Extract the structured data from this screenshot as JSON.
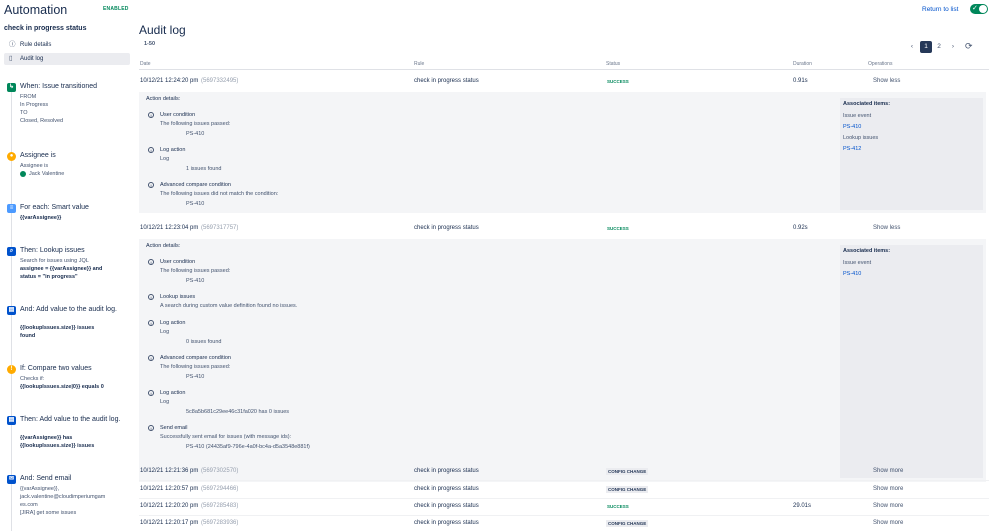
{
  "header": {
    "app_title": "Automation",
    "status_badge": "ENABLED",
    "return_link": "Return to list",
    "toggle_on": true
  },
  "sidebar": {
    "rule_name": "check in progress status",
    "nav": [
      {
        "label": "Rule details",
        "icon": "info-icon"
      },
      {
        "label": "Audit log",
        "icon": "document-icon",
        "active": true
      }
    ],
    "steps": [
      {
        "title": "When: Issue transitioned",
        "icon": "trigger-icon",
        "color": "#00875a",
        "lines": [
          "FROM",
          "In Progress",
          "TO",
          "Closed, Resolved"
        ]
      },
      {
        "title": "Assignee is",
        "icon": "user-condition-icon",
        "color": "#ffab00",
        "lines": [
          "Assignee is",
          "Jack Valentine"
        ]
      },
      {
        "title": "For each: Smart value",
        "icon": "branch-icon",
        "color": "#4c9aff",
        "lines": [
          "{{varAssignee}}"
        ]
      },
      {
        "title": "Then: Lookup issues",
        "icon": "lookup-icon",
        "color": "#0052cc",
        "lines": [
          "Search for issues using JQL",
          "assignee = {{varAssignee}} and",
          "status = \"in progress\""
        ]
      },
      {
        "title": "And: Add value to the audit log.",
        "icon": "log-icon",
        "color": "#0052cc",
        "lines": [
          "{{lookupIssues.size}} issues",
          "found"
        ]
      },
      {
        "title": "If: Compare two values",
        "icon": "compare-icon",
        "color": "#ffab00",
        "lines": [
          "Checks if:",
          "{{lookupIssues.size|0}} equals 0"
        ]
      },
      {
        "title": "Then: Add value to the audit log.",
        "icon": "log-icon",
        "color": "#0052cc",
        "lines": [
          "{{varAssignee}} has",
          "{{lookupIssues.size}} issues"
        ]
      },
      {
        "title": "And: Send email",
        "icon": "email-icon",
        "color": "#0052cc",
        "lines": [
          "{{varAssignee}},",
          "jack.valentine@cloudimperiumgam",
          "es.com",
          "[JIRA] get some issues"
        ]
      }
    ]
  },
  "main": {
    "title": "Audit log",
    "range": "1-50",
    "pages": [
      "1",
      "2"
    ],
    "current_page": "1",
    "columns": [
      "Date",
      "Rule",
      "Status",
      "Duration",
      "Operations"
    ],
    "rows": [
      {
        "date": "10/12/21 12:24:20 pm",
        "id": "(5697332495)",
        "rule": "check in progress status",
        "status": "SUCCESS",
        "duration": "0.91s",
        "op": "Show less"
      },
      {
        "date": "10/12/21 12:23:04 pm",
        "id": "(5697317757)",
        "rule": "check in progress status",
        "status": "SUCCESS",
        "duration": "0.92s",
        "op": "Show less"
      },
      {
        "date": "10/12/21 12:21:36 pm",
        "id": "(5697302570)",
        "rule": "check in progress status",
        "status": "CONFIG CHANGE",
        "duration": "",
        "op": "Show more"
      },
      {
        "date": "10/12/21 12:20:57 pm",
        "id": "(5697294466)",
        "rule": "check in progress status",
        "status": "CONFIG CHANGE",
        "duration": "",
        "op": "Show more"
      },
      {
        "date": "10/12/21 12:20:20 pm",
        "id": "(5697285483)",
        "rule": "check in progress status",
        "status": "SUCCESS",
        "duration": "29.01s",
        "op": "Show more"
      },
      {
        "date": "10/12/21 12:20:17 pm",
        "id": "(5697283936)",
        "rule": "check in progress status",
        "status": "CONFIG CHANGE",
        "duration": "",
        "op": "Show more"
      }
    ],
    "details": [
      {
        "title": "Action details:",
        "actions": [
          {
            "name": "User condition",
            "lines": [
              "The following issues passed:"
            ],
            "items": [
              "PS-410"
            ]
          },
          {
            "name": "Log action",
            "lines": [
              "Log"
            ],
            "items": [
              "1 issues found"
            ]
          },
          {
            "name": "Advanced compare condition",
            "lines": [
              "The following issues did not match the condition:"
            ],
            "items": [
              "PS-410"
            ]
          }
        ],
        "associated": {
          "heading": "Associated items:",
          "groups": [
            {
              "label": "Issue event",
              "links": [
                "PS-410"
              ]
            },
            {
              "label": "Lookup issues",
              "links": [
                "PS-412"
              ]
            }
          ]
        }
      },
      {
        "title": "Action details:",
        "actions": [
          {
            "name": "User condition",
            "lines": [
              "The following issues passed:"
            ],
            "items": [
              "PS-410"
            ]
          },
          {
            "name": "Lookup issues",
            "lines": [
              "A search during custom value definition found no issues."
            ],
            "items": []
          },
          {
            "name": "Log action",
            "lines": [
              "Log"
            ],
            "items": [
              "0 issues found"
            ]
          },
          {
            "name": "Advanced compare condition",
            "lines": [
              "The following issues passed:"
            ],
            "items": [
              "PS-410"
            ]
          },
          {
            "name": "Log action",
            "lines": [
              "Log"
            ],
            "items": [
              "5c8a5b681c29ee46c31fa020 has 0 issues"
            ]
          },
          {
            "name": "Send email",
            "lines": [
              "Successfully sent email for issues (with message ids):"
            ],
            "items": [
              "PS-410 (24435af9-796e-4a0f-bc4a-d5a3548e881f)"
            ]
          }
        ],
        "associated": {
          "heading": "Associated items:",
          "groups": [
            {
              "label": "Issue event",
              "links": [
                "PS-410"
              ]
            }
          ]
        }
      }
    ]
  }
}
